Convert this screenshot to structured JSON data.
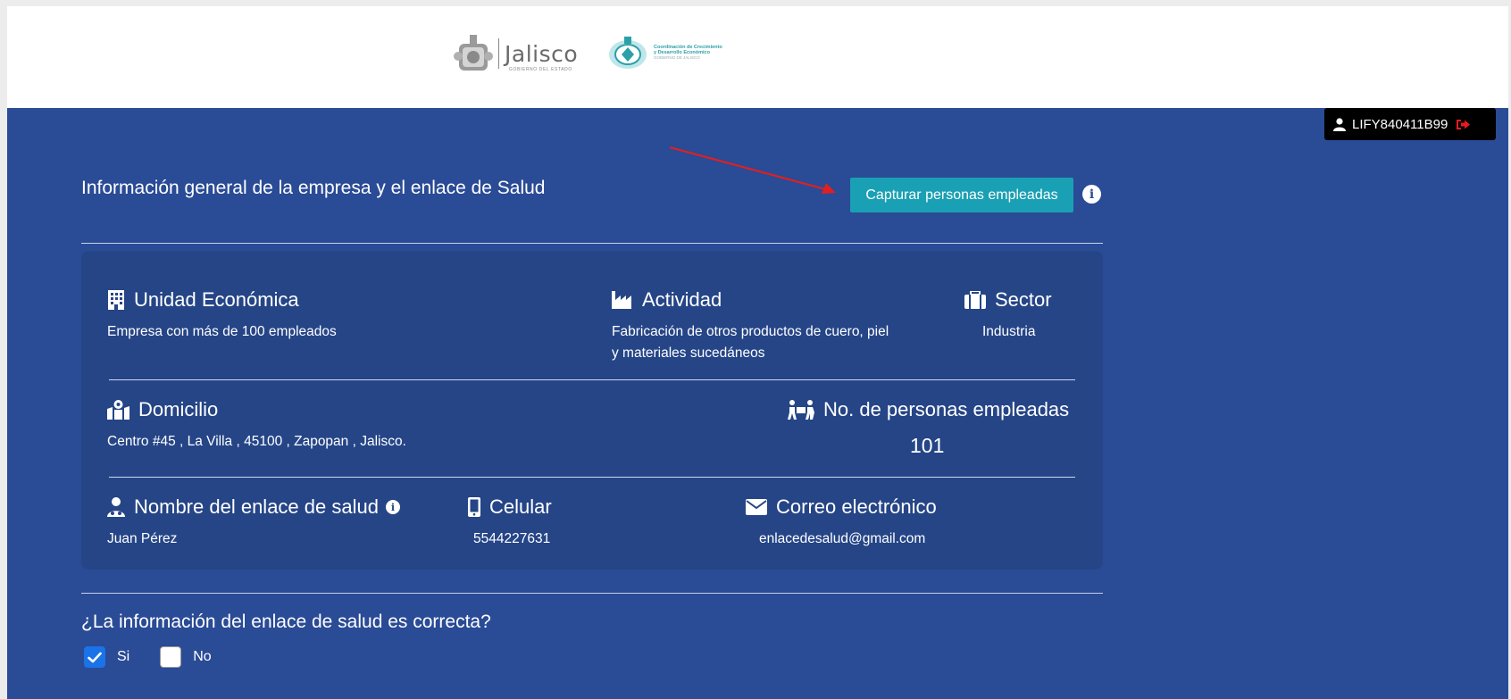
{
  "header": {
    "logo_jalisco": "Jalisco",
    "logo_jalisco_sub": "GOBIERNO DEL ESTADO",
    "logo_coord_line1": "Coordinación de Crecimiento",
    "logo_coord_line2": "y Desarrollo Económico",
    "logo_coord_line3": "GOBIERNO DE JALISCO"
  },
  "user": {
    "id": "LIFY840411B99",
    "icon": "user-icon",
    "logout_icon": "sign-out-icon"
  },
  "section": {
    "title": "Información general de la empresa y el enlace de Salud",
    "capture_button": "Capturar personas empleadas",
    "info_icon": "info-circle-icon"
  },
  "company": {
    "unidad": {
      "label": "Unidad Económica",
      "value": "Empresa con más de 100 empleados",
      "icon": "building-icon"
    },
    "actividad": {
      "label": "Actividad",
      "value_line1": "Fabricación de otros productos de cuero, piel",
      "value_line2": "y materiales sucedáneos",
      "icon": "industry-icon"
    },
    "sector": {
      "label": "Sector",
      "value": "Industria",
      "icon": "briefcase-icon"
    },
    "domicilio": {
      "label": "Domicilio",
      "value": "Centro #45 , La Villa ,  45100 , Zapopan , Jalisco.",
      "icon": "map-marked-icon"
    },
    "empleados": {
      "label": "No. de personas empleadas",
      "value": "101",
      "icon": "people-carry-icon"
    },
    "enlace": {
      "label": "Nombre del enlace de salud",
      "value": "Juan Pérez",
      "icon": "user-md-icon"
    },
    "celular": {
      "label": "Celular",
      "value": "5544227631",
      "icon": "mobile-icon"
    },
    "correo": {
      "label": "Correo electrónico",
      "value": "enlacedesalud@gmail.com",
      "icon": "envelope-icon"
    }
  },
  "question": {
    "text": "¿La información del enlace de salud es correcta?",
    "yes_label": "Si",
    "no_label": "No",
    "yes_checked": true,
    "no_checked": false
  },
  "colors": {
    "background": "#2a4b96",
    "card": "#254587",
    "button": "#1aa0b4",
    "checkbox": "#1a73e8",
    "arrow": "#e02020"
  }
}
